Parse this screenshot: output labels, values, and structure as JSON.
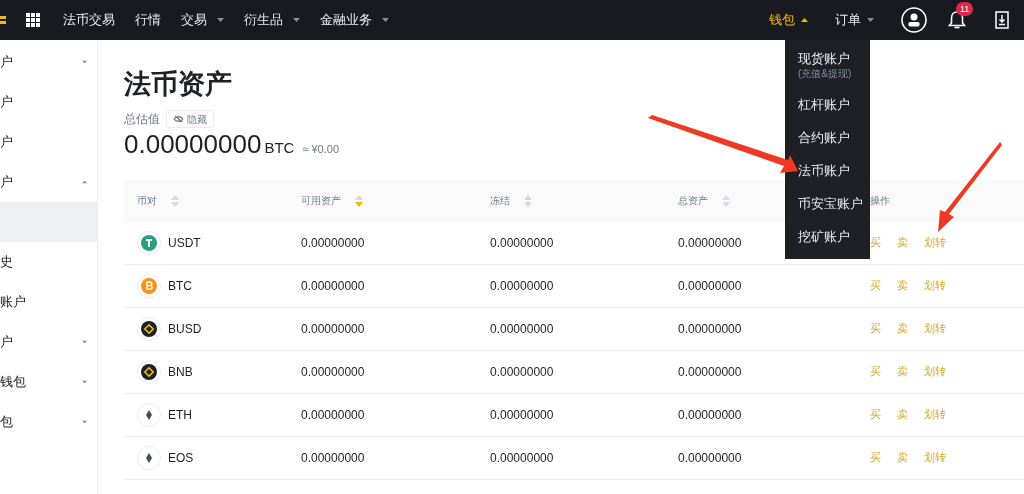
{
  "topbar": {
    "nav": [
      {
        "label": "法币交易",
        "caret": false
      },
      {
        "label": "行情",
        "caret": false
      },
      {
        "label": "交易",
        "caret": true
      },
      {
        "label": "衍生品",
        "caret": true
      },
      {
        "label": "金融业务",
        "caret": true
      }
    ],
    "menus": [
      {
        "label": "钱包",
        "selected": true
      },
      {
        "label": "订单",
        "selected": false
      }
    ],
    "notification_count": "11"
  },
  "wallet_menu": [
    {
      "label": "现货账户",
      "note": "(充值&提现)"
    },
    {
      "label": "杠杆账户"
    },
    {
      "label": "合约账户"
    },
    {
      "label": "法币账户"
    },
    {
      "label": "币安宝账户"
    },
    {
      "label": "挖矿账户"
    }
  ],
  "sidebar": {
    "items": [
      {
        "kind": "group",
        "label": "户",
        "expanded": false,
        "selected": false
      },
      {
        "kind": "link",
        "label": "户",
        "selected": false
      },
      {
        "kind": "link",
        "label": "户",
        "selected": false
      },
      {
        "kind": "group",
        "label": "户",
        "expanded": true,
        "selected": false
      },
      {
        "kind": "link",
        "selected": true
      },
      {
        "kind": "link",
        "label": "史",
        "selected": false
      },
      {
        "kind": "link",
        "label": "账户",
        "selected": false
      },
      {
        "kind": "group",
        "label": "户",
        "expanded": false,
        "selected": false
      },
      {
        "kind": "group",
        "label": "钱包",
        "expanded": false,
        "selected": false
      },
      {
        "kind": "group",
        "label": "包",
        "expanded": false,
        "selected": false
      }
    ]
  },
  "page": {
    "title": "法币资产",
    "estimate_label": "总估值",
    "hide_button": "隐藏",
    "total": "0.00000000",
    "total_unit": "BTC",
    "total_fiat": "≈ ¥0.00"
  },
  "table": {
    "columns": [
      {
        "label": "币对",
        "sorted": false
      },
      {
        "label": "可用资产",
        "sorted": true
      },
      {
        "label": "冻结",
        "sorted": false
      },
      {
        "label": "总资产",
        "sorted": false
      },
      {
        "label": "操作"
      }
    ],
    "rows": [
      {
        "coin": "USDT",
        "color": "#26a17b",
        "available": "0.00000000",
        "frozen": "0.00000000",
        "total": "0.00000000",
        "actions": [
          "买",
          "卖",
          "划转"
        ]
      },
      {
        "coin": "BTC",
        "color": "#f7931a",
        "available": "0.00000000",
        "frozen": "0.00000000",
        "total": "0.00000000",
        "actions": [
          "买",
          "卖",
          "划转"
        ]
      },
      {
        "coin": "BUSD",
        "color": "#1e2026",
        "available": "0.00000000",
        "frozen": "0.00000000",
        "total": "0.00000000",
        "actions": [
          "买",
          "卖",
          "划转"
        ]
      },
      {
        "coin": "BNB",
        "color": "#1e2026",
        "available": "0.00000000",
        "frozen": "0.00000000",
        "total": "0.00000000",
        "actions": [
          "买",
          "卖",
          "划转"
        ]
      },
      {
        "coin": "ETH",
        "color": "#ffffff",
        "available": "0.00000000",
        "frozen": "0.00000000",
        "total": "0.00000000",
        "actions": [
          "买",
          "卖",
          "划转"
        ]
      },
      {
        "coin": "EOS",
        "color": "#ffffff",
        "available": "0.00000000",
        "frozen": "0.00000000",
        "total": "0.00000000",
        "actions": [
          "买",
          "卖",
          "划转"
        ]
      }
    ]
  }
}
